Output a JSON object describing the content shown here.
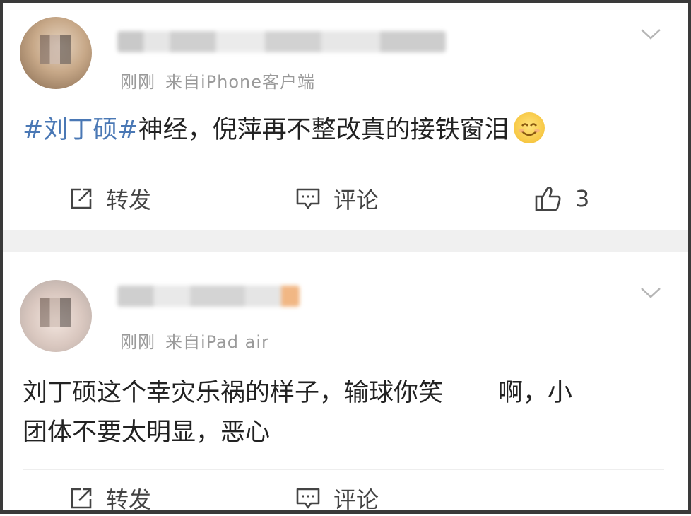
{
  "posts": [
    {
      "meta_time": "刚刚",
      "meta_source": "来自iPhone客户端",
      "content_tag": "#刘丁硕#",
      "content_text": "神经，倪萍再不整改真的接铁窗泪",
      "emoji_icon": "smiling-face-icon",
      "actions": {
        "share": "转发",
        "comment": "评论",
        "like_count": "3"
      }
    },
    {
      "meta_time": "刚刚",
      "meta_source": "来自iPad air",
      "content_line1_part1": "刘丁硕这个幸灾乐祸的样子，输球你笑",
      "content_line1_part2": "啊，小",
      "content_line2": "团体不要太明显，恶心",
      "actions": {
        "share": "转发",
        "comment": "评论"
      }
    }
  ],
  "colors": {
    "hashtag": "#4a78b5",
    "meta": "#9a9a9a",
    "text": "#222222",
    "separator": "#f0f0f0"
  }
}
